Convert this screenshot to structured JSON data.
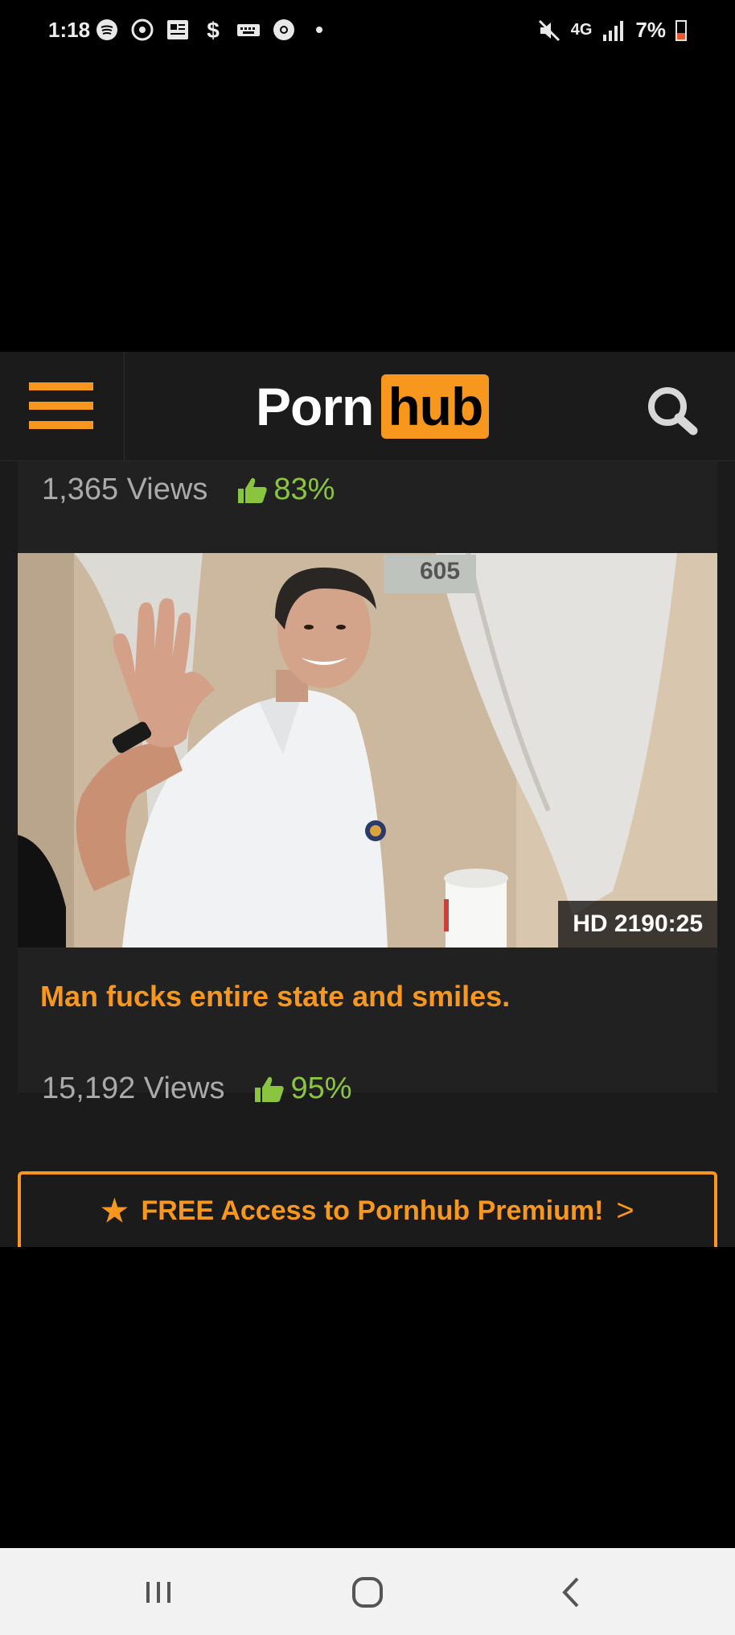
{
  "status_bar": {
    "time": "1:18",
    "network": "4G",
    "battery_percent": "7%",
    "icons": [
      "spotify-icon",
      "camera-sync-icon",
      "news-icon",
      "dollar-icon",
      "keyboard-icon",
      "chrome-icon",
      "dot-icon"
    ]
  },
  "header": {
    "logo_part1": "Porn",
    "logo_part2": "hub"
  },
  "previous_video": {
    "views": "1,365 Views",
    "rating": "83%"
  },
  "video": {
    "thumbnail_sign": "605",
    "duration": "HD 2190:25",
    "title": "Man fucks entire state and smiles.",
    "views": "15,192 Views",
    "rating": "95%"
  },
  "premium_banner": {
    "label": "FREE Access to Pornhub Premium!"
  },
  "colors": {
    "accent": "#f7971d",
    "rating_green": "#8ac540",
    "background": "#1b1b1b",
    "card": "#212121"
  }
}
